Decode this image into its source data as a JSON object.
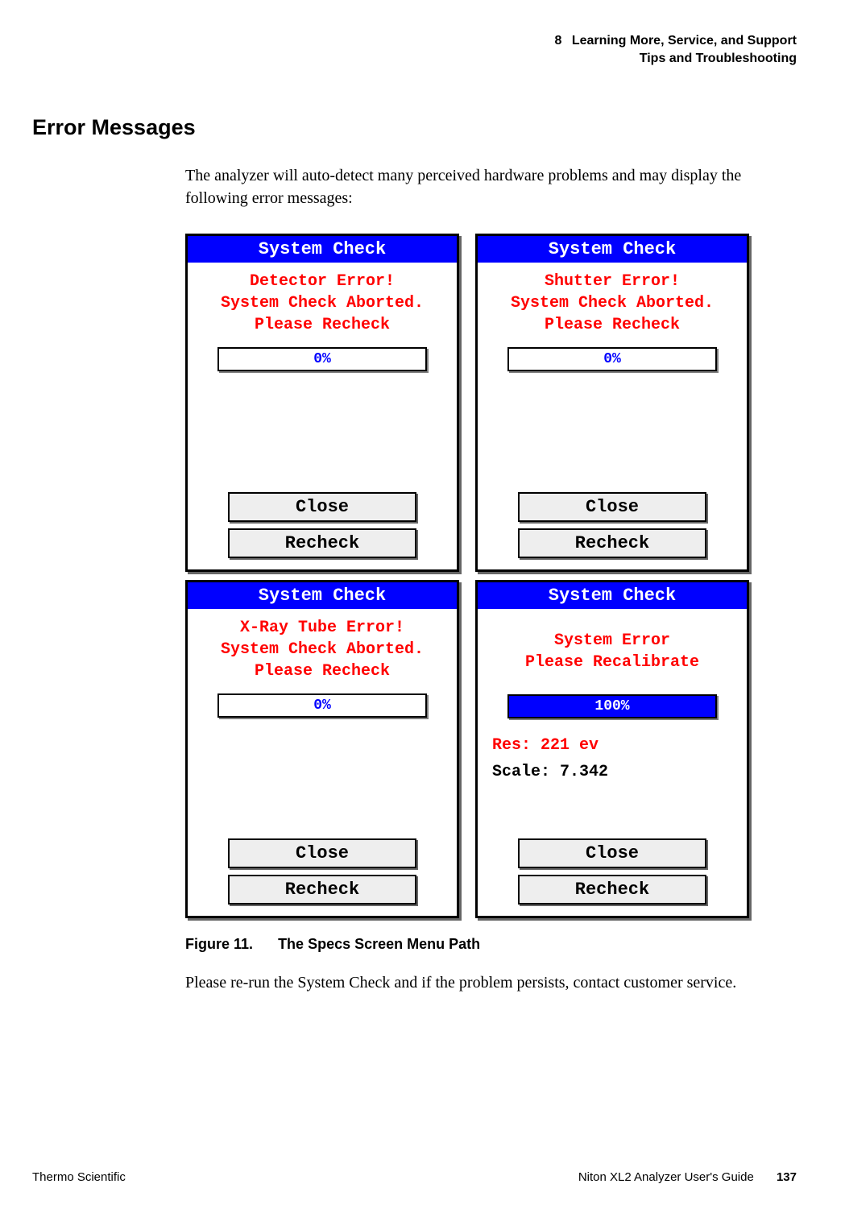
{
  "header": {
    "chapter_number": "8",
    "chapter_title": "Learning More, Service, and Support",
    "subheading": "Tips and Troubleshooting"
  },
  "section_title": "Error Messages",
  "intro_text": "The analyzer will auto-detect many perceived hardware problems and may display the following error messages:",
  "panels": [
    {
      "title": "System Check",
      "message": "Detector Error!\nSystem Check Aborted.\nPlease Recheck",
      "progress_percent": "0%",
      "progress_fill_pct": 0,
      "close_label": "Close",
      "recheck_label": "Recheck"
    },
    {
      "title": "System Check",
      "message": "Shutter Error!\nSystem Check Aborted.\nPlease Recheck",
      "progress_percent": "0%",
      "progress_fill_pct": 0,
      "close_label": "Close",
      "recheck_label": "Recheck"
    },
    {
      "title": "System Check",
      "message": "X-Ray Tube Error!\nSystem Check Aborted.\nPlease Recheck",
      "progress_percent": "0%",
      "progress_fill_pct": 0,
      "close_label": "Close",
      "recheck_label": "Recheck"
    },
    {
      "title": "System Check",
      "message": "System Error\nPlease Recalibrate",
      "progress_percent": "100%",
      "progress_fill_pct": 100,
      "res_line": "Res: 221 ev",
      "scale_line": "Scale: 7.342",
      "close_label": "Close",
      "recheck_label": "Recheck"
    }
  ],
  "figure": {
    "label": "Figure 11.",
    "caption": "The Specs Screen Menu Path"
  },
  "closing_text": "Please re-run the System Check and if the problem persists, contact customer service.",
  "footer": {
    "left": "Thermo Scientific",
    "guide": "Niton XL2 Analyzer User's Guide",
    "page_number": "137"
  }
}
